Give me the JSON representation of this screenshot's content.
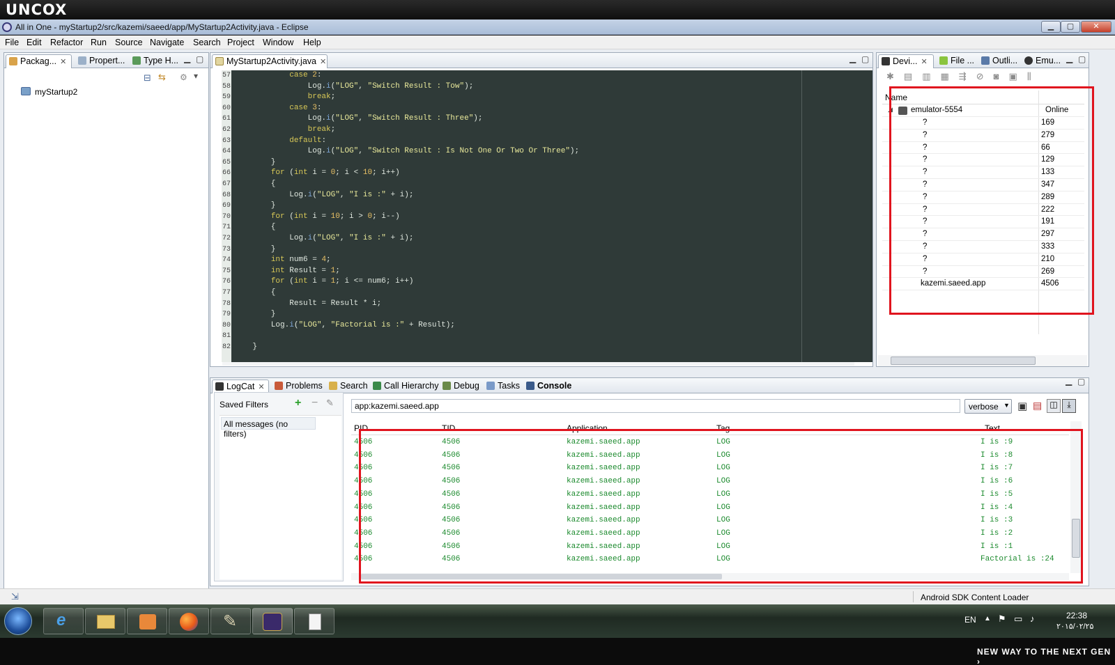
{
  "brand": "uncox",
  "window": {
    "title": "All in One - myStartup2/src/kazemi/saeed/app/MyStartup2Activity.java - Eclipse",
    "min": "▁",
    "max": "▢",
    "close": "✕"
  },
  "menu": [
    "File",
    "Edit",
    "Refactor",
    "Run",
    "Source",
    "Navigate",
    "Search",
    "Project",
    "Window",
    "Help"
  ],
  "left_tabs": [
    "Packag...",
    "Propert...",
    "Type H..."
  ],
  "package_explorer": {
    "project": "myStartup2"
  },
  "editor": {
    "tab": "MyStartup2Activity.java",
    "line_numbers": [
      "57",
      "58",
      "59",
      "60",
      "61",
      "62",
      "63",
      "64",
      "65",
      "66",
      "67",
      "68",
      "69",
      "70",
      "71",
      "72",
      "73",
      "74",
      "75",
      "76",
      "77",
      "78",
      "79",
      "80",
      "81",
      "82"
    ],
    "lines": [
      "            case 2:",
      "                Log.i(\"LOG\", \"Switch Result : Tow\");",
      "                break;",
      "            case 3:",
      "                Log.i(\"LOG\", \"Switch Result : Three\");",
      "                break;",
      "            default:",
      "                Log.i(\"LOG\", \"Switch Result : Is Not One Or Two Or Three\");",
      "        }",
      "        for (int i = 0; i < 10; i++)",
      "        {",
      "            Log.i(\"LOG\", \"I is :\" + i);",
      "        }",
      "        for (int i = 10; i > 0; i--)",
      "        {",
      "            Log.i(\"LOG\", \"I is :\" + i);",
      "        }",
      "        int num6 = 4;",
      "        int Result = 1;",
      "        for (int i = 1; i <= num6; i++)",
      "        {",
      "            Result = Result * i;",
      "        }",
      "        Log.i(\"LOG\", \"Factorial is :\" + Result);",
      "",
      "    }"
    ]
  },
  "right_tabs": [
    "Devi...",
    "File ...",
    "Outli...",
    "Emu..."
  ],
  "devices": {
    "col_name": "Name",
    "device": {
      "name": "emulator-5554",
      "status": "Online"
    },
    "processes": [
      {
        "name": "?",
        "pid": "169"
      },
      {
        "name": "?",
        "pid": "279"
      },
      {
        "name": "?",
        "pid": "66"
      },
      {
        "name": "?",
        "pid": "129"
      },
      {
        "name": "?",
        "pid": "133"
      },
      {
        "name": "?",
        "pid": "347"
      },
      {
        "name": "?",
        "pid": "289"
      },
      {
        "name": "?",
        "pid": "222"
      },
      {
        "name": "?",
        "pid": "191"
      },
      {
        "name": "?",
        "pid": "297"
      },
      {
        "name": "?",
        "pid": "333"
      },
      {
        "name": "?",
        "pid": "210"
      },
      {
        "name": "?",
        "pid": "269"
      },
      {
        "name": "kazemi.saeed.app",
        "pid": "4506"
      }
    ]
  },
  "bottom_tabs": [
    "LogCat",
    "Problems",
    "Search",
    "Call Hierarchy",
    "Debug",
    "Tasks",
    "Console"
  ],
  "logcat": {
    "saved_filters_label": "Saved Filters",
    "all_messages": "All messages (no filters)",
    "filter_value": "app:kazemi.saeed.app",
    "level": "verbose",
    "columns": [
      "PID",
      "TID",
      "Application",
      "Tag",
      "Text"
    ],
    "rows": [
      {
        "pid": "4506",
        "tid": "4506",
        "app": "kazemi.saeed.app",
        "tag": "LOG",
        "text": "I is :9"
      },
      {
        "pid": "4506",
        "tid": "4506",
        "app": "kazemi.saeed.app",
        "tag": "LOG",
        "text": "I is :8"
      },
      {
        "pid": "4506",
        "tid": "4506",
        "app": "kazemi.saeed.app",
        "tag": "LOG",
        "text": "I is :7"
      },
      {
        "pid": "4506",
        "tid": "4506",
        "app": "kazemi.saeed.app",
        "tag": "LOG",
        "text": "I is :6"
      },
      {
        "pid": "4506",
        "tid": "4506",
        "app": "kazemi.saeed.app",
        "tag": "LOG",
        "text": "I is :5"
      },
      {
        "pid": "4506",
        "tid": "4506",
        "app": "kazemi.saeed.app",
        "tag": "LOG",
        "text": "I is :4"
      },
      {
        "pid": "4506",
        "tid": "4506",
        "app": "kazemi.saeed.app",
        "tag": "LOG",
        "text": "I is :3"
      },
      {
        "pid": "4506",
        "tid": "4506",
        "app": "kazemi.saeed.app",
        "tag": "LOG",
        "text": "I is :2"
      },
      {
        "pid": "4506",
        "tid": "4506",
        "app": "kazemi.saeed.app",
        "tag": "LOG",
        "text": "I is :1"
      },
      {
        "pid": "4506",
        "tid": "4506",
        "app": "kazemi.saeed.app",
        "tag": "LOG",
        "text": "Factorial is :24"
      }
    ]
  },
  "status": {
    "loader": "Android SDK Content Loader"
  },
  "taskbar": {
    "apps": [
      "start-orb-icon",
      "internet-explorer-icon",
      "file-explorer-icon",
      "media-player-icon",
      "firefox-icon",
      "paint-icon",
      "java-ee-ide-icon",
      "notepad-icon"
    ],
    "lang": "EN",
    "time": "22:38",
    "date": "۲۰۱۵/۰۲/۲۵"
  },
  "footer_tagline": "NEW WAY TO THE NEXT GEN ›",
  "colors": {
    "highlight": "#e0141e",
    "log_text": "#1b8a2d",
    "editor_bg": "#2f3a38"
  }
}
